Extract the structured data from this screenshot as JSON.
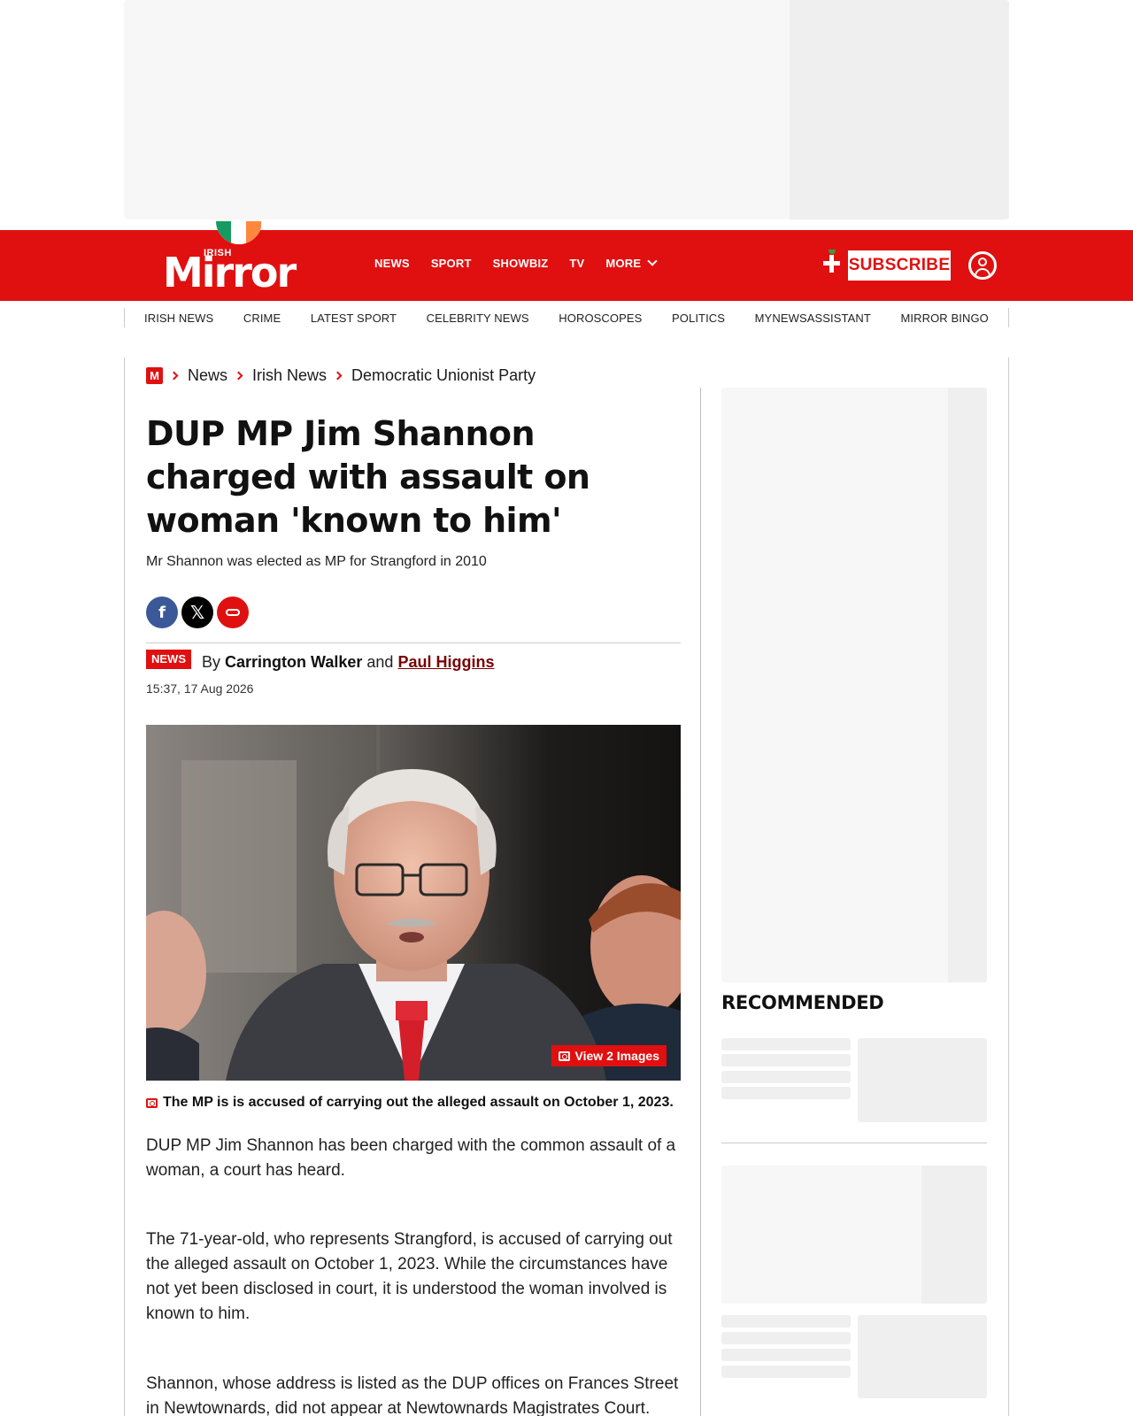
{
  "brand": {
    "logo_small": "IRISH",
    "logo_word": "Mirror",
    "flag_colors": [
      "#169b62",
      "#ffffff",
      "#ff883e"
    ],
    "accent": "#e01010"
  },
  "main_nav": {
    "items": [
      "NEWS",
      "SPORT",
      "SHOWBIZ",
      "TV"
    ],
    "more_label": "MORE"
  },
  "header_actions": {
    "subscribe_label": "SUBSCRIBE",
    "account_icon": "user-circle-icon"
  },
  "section_nav": [
    "IRISH NEWS",
    "CRIME",
    "LATEST SPORT",
    "CELEBRITY NEWS",
    "HOROSCOPES",
    "POLITICS",
    "MYNEWSASSISTANT",
    "MIRROR BINGO"
  ],
  "breadcrumb": {
    "home_icon": "M",
    "items": [
      "News",
      "Irish News",
      "Democratic Unionist Party"
    ]
  },
  "article": {
    "headline": "DUP MP Jim Shannon charged with assault on woman 'known to him'",
    "standfirst": "Mr Shannon was elected as MP for Strangford in 2010",
    "share_icons": [
      "facebook-icon",
      "x-icon",
      "link-icon"
    ],
    "tag": "NEWS",
    "byline_prefix": "By",
    "author1": "Carrington Walker",
    "byline_and": "and",
    "author2": "Paul Higgins",
    "date": "15:37, 17 Aug 2026",
    "gallery_label": "View 2 Images",
    "caption": "The MP is is accused of carrying out the alleged assault on October 1, 2023.",
    "paragraphs": [
      "DUP MP Jim Shannon has been charged with the common assault of a woman, a court has heard.",
      "The 71-year-old, who represents Strangford, is accused of carrying out the alleged assault on October 1, 2023. While the circumstances have not yet been disclosed in court, it is understood the woman involved is known to him.",
      "Shannon, whose address is listed as the DUP offices on Frances Street in Newtownards, did not appear at Newtownards Magistrates Court."
    ]
  },
  "sidebar": {
    "recommended_title": "RECOMMENDED"
  }
}
